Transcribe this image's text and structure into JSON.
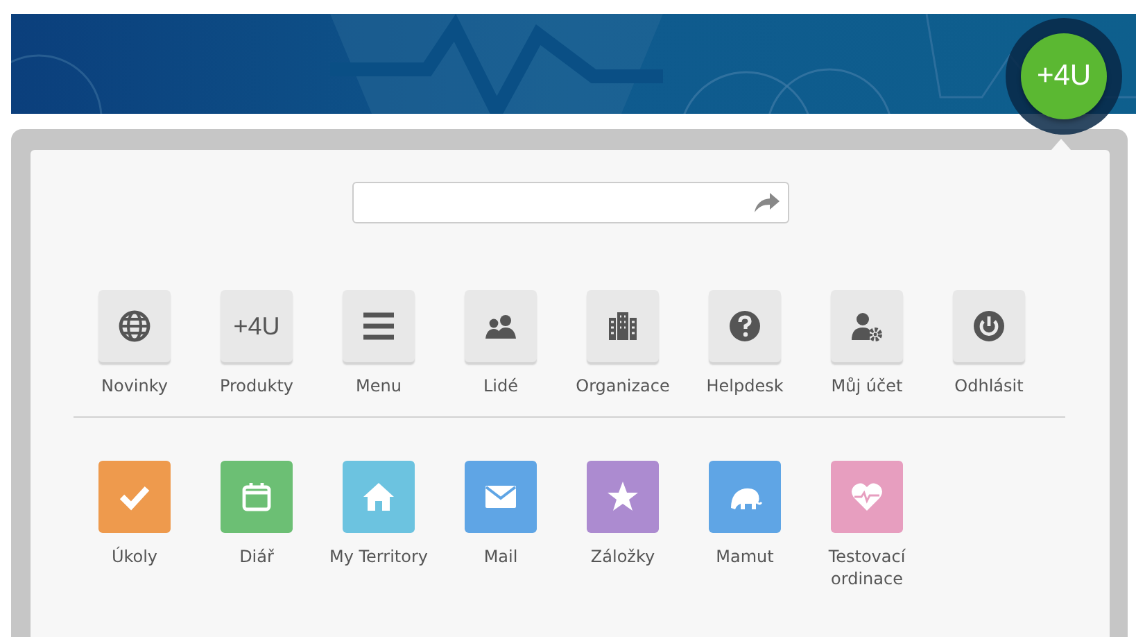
{
  "header": {
    "logo": "+4U"
  },
  "search": {
    "kind": "share-field"
  },
  "system_items": [
    {
      "label": "Novinky",
      "kind": "globe"
    },
    {
      "label": "Produkty",
      "kind": "text",
      "glyph": "+4U"
    },
    {
      "label": "Menu",
      "kind": "menu"
    },
    {
      "label": "Lidé",
      "kind": "people"
    },
    {
      "label": "Organizace",
      "kind": "building"
    },
    {
      "label": "Helpdesk",
      "kind": "help"
    },
    {
      "label": "Můj účet",
      "kind": "account"
    },
    {
      "label": "Odhlásit",
      "kind": "power"
    }
  ],
  "apps": [
    {
      "label": "Úkoly",
      "kind": "check",
      "color": "#ee9a4d"
    },
    {
      "label": "Diář",
      "kind": "calendar",
      "color": "#6cbf74"
    },
    {
      "label": "My Territory",
      "kind": "home",
      "color": "#6cc3e0"
    },
    {
      "label": "Mail",
      "kind": "mail",
      "color": "#5fa5e5"
    },
    {
      "label": "Záložky",
      "kind": "star",
      "color": "#ac8bd0"
    },
    {
      "label": "Mamut",
      "kind": "mammoth",
      "color": "#5fa5e5"
    },
    {
      "label": "Testovací ordinace",
      "kind": "heart",
      "color": "#e79ebf"
    }
  ]
}
